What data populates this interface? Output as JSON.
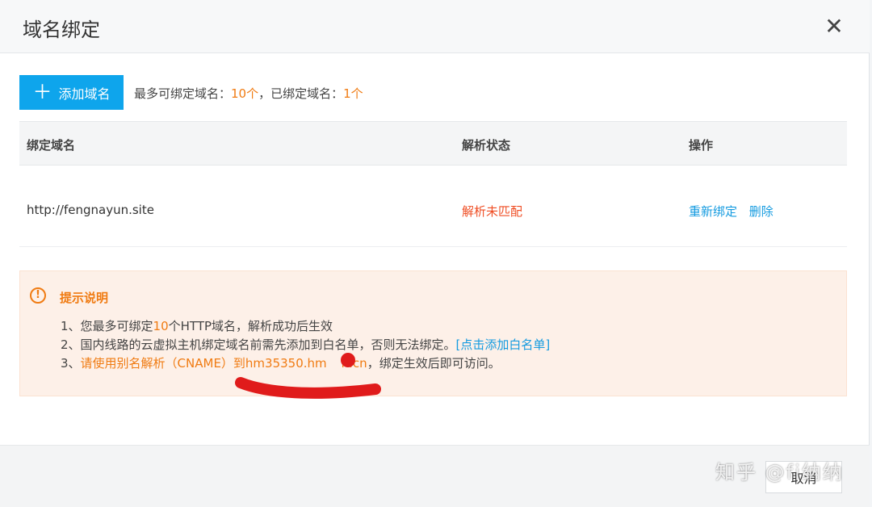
{
  "dialog": {
    "title": "域名绑定",
    "close_glyph": "✕"
  },
  "toolbar": {
    "add_label": "添加域名",
    "quota_max_label": "最多可绑定域名：",
    "quota_max_value": "10个",
    "quota_sep": "，已绑定域名：",
    "quota_bound_value": "1个"
  },
  "table": {
    "headers": [
      "绑定域名",
      "解析状态",
      "操作"
    ],
    "rows": [
      {
        "domain": "http://fengnayun.site",
        "status": "解析未匹配",
        "actions": [
          "重新绑定",
          "删除"
        ]
      }
    ]
  },
  "notice": {
    "title": "提示说明",
    "line1_a": "1、您最多可绑定",
    "line1_b": "10",
    "line1_c": "个HTTP域名，解析成功后生效",
    "line2_a": "2、国内线路的云虚拟主机绑定域名前需先添加到白名单，否则无法绑定。",
    "line2_link": "[点击添加白名单]",
    "line3_a": "3、",
    "line3_b": "请使用别名解析（CNAME）到hm35350.hm",
    "line3_c": "n.cn",
    "line3_d": "，绑定生效后即可访问。"
  },
  "footer": {
    "cancel_label": "取消"
  },
  "watermark": "知乎 @fi纳纳",
  "colors": {
    "primary": "#0ea5ec",
    "accent": "#f07b12",
    "error": "#ef4d23",
    "link": "#159be0",
    "redaction": "#e01b1b"
  }
}
